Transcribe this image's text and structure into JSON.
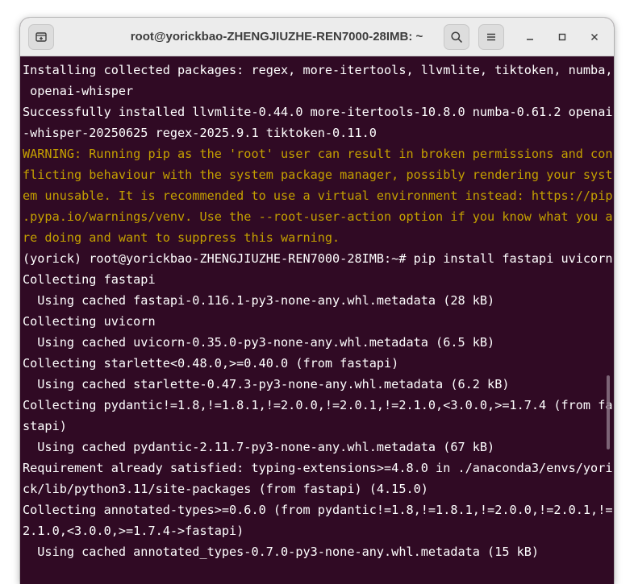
{
  "window": {
    "title": "root@yorickbao-ZHENGJIUZHE-REN7000-28IMB: ~"
  },
  "titlebar": {
    "new_tab_icon": "new-tab-icon",
    "search_icon": "search-icon",
    "menu_icon": "hamburger-menu-icon",
    "minimize_icon": "minimize-icon",
    "maximize_icon": "maximize-icon",
    "close_icon": "close-icon"
  },
  "colors": {
    "terminal_bg": "#300a24",
    "terminal_fg": "#ffffff",
    "warning_fg": "#c4a000",
    "titlebar_bg": "#ececec"
  },
  "terminal": {
    "lines": [
      {
        "text": "Installing collected packages: regex, more-itertools, llvmlite, tiktoken, numba,",
        "style": "normal"
      },
      {
        "text": " openai-whisper",
        "style": "normal"
      },
      {
        "text": "Successfully installed llvmlite-0.44.0 more-itertools-10.8.0 numba-0.61.2 openai",
        "style": "normal"
      },
      {
        "text": "-whisper-20250625 regex-2025.9.1 tiktoken-0.11.0",
        "style": "normal"
      },
      {
        "text": "WARNING: Running pip as the 'root' user can result in broken permissions and con",
        "style": "warning"
      },
      {
        "text": "flicting behaviour with the system package manager, possibly rendering your syst",
        "style": "warning"
      },
      {
        "text": "em unusable. It is recommended to use a virtual environment instead: https://pip",
        "style": "warning"
      },
      {
        "text": ".pypa.io/warnings/venv. Use the --root-user-action option if you know what you a",
        "style": "warning"
      },
      {
        "text": "re doing and want to suppress this warning.",
        "style": "warning"
      },
      {
        "text": "(yorick) root@yorickbao-ZHENGJIUZHE-REN7000-28IMB:~# pip install fastapi uvicorn",
        "style": "normal"
      },
      {
        "text": "Collecting fastapi",
        "style": "normal"
      },
      {
        "text": "  Using cached fastapi-0.116.1-py3-none-any.whl.metadata (28 kB)",
        "style": "normal"
      },
      {
        "text": "Collecting uvicorn",
        "style": "normal"
      },
      {
        "text": "  Using cached uvicorn-0.35.0-py3-none-any.whl.metadata (6.5 kB)",
        "style": "normal"
      },
      {
        "text": "Collecting starlette<0.48.0,>=0.40.0 (from fastapi)",
        "style": "normal"
      },
      {
        "text": "  Using cached starlette-0.47.3-py3-none-any.whl.metadata (6.2 kB)",
        "style": "normal"
      },
      {
        "text": "Collecting pydantic!=1.8,!=1.8.1,!=2.0.0,!=2.0.1,!=2.1.0,<3.0.0,>=1.7.4 (from fa",
        "style": "normal"
      },
      {
        "text": "stapi)",
        "style": "normal"
      },
      {
        "text": "  Using cached pydantic-2.11.7-py3-none-any.whl.metadata (67 kB)",
        "style": "normal"
      },
      {
        "text": "Requirement already satisfied: typing-extensions>=4.8.0 in ./anaconda3/envs/yori",
        "style": "normal"
      },
      {
        "text": "ck/lib/python3.11/site-packages (from fastapi) (4.15.0)",
        "style": "normal"
      },
      {
        "text": "Collecting annotated-types>=0.6.0 (from pydantic!=1.8,!=1.8.1,!=2.0.0,!=2.0.1,!=",
        "style": "normal"
      },
      {
        "text": "2.1.0,<3.0.0,>=1.7.4->fastapi)",
        "style": "normal"
      },
      {
        "text": "  Using cached annotated_types-0.7.0-py3-none-any.whl.metadata (15 kB)",
        "style": "normal"
      }
    ]
  }
}
